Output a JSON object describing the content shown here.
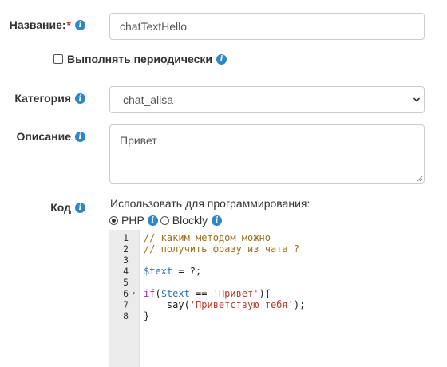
{
  "form": {
    "name": {
      "label": "Название:",
      "required_mark": "*",
      "value": "chatTextHello"
    },
    "periodic": {
      "label": "Выполнять периодически",
      "checked": false
    },
    "category": {
      "label": "Категория",
      "value": "chat_alisa"
    },
    "description": {
      "label": "Описание",
      "value": "Привет"
    },
    "code": {
      "label": "Код",
      "hint": "Использовать для программирования:",
      "options": [
        {
          "label": "PHP",
          "checked": true
        },
        {
          "label": "Blockly",
          "checked": false
        }
      ]
    }
  },
  "editor": {
    "line_numbers": [
      "1",
      "2",
      "3",
      "4",
      "5",
      "6",
      "7",
      "8"
    ],
    "lines": [
      [
        {
          "t": "comment",
          "v": "// каким методом можно"
        }
      ],
      [
        {
          "t": "comment",
          "v": "// получить фразу из чата ?"
        }
      ],
      [],
      [
        {
          "t": "var",
          "v": "$text"
        },
        {
          "t": "plain",
          "v": " = ?;"
        }
      ],
      [],
      [
        {
          "t": "kw",
          "v": "if"
        },
        {
          "t": "plain",
          "v": "("
        },
        {
          "t": "var",
          "v": "$text"
        },
        {
          "t": "plain",
          "v": " == "
        },
        {
          "t": "str",
          "v": "'Привет'"
        },
        {
          "t": "plain",
          "v": "){"
        }
      ],
      [
        {
          "t": "plain",
          "v": "    say("
        },
        {
          "t": "str",
          "v": "'Приветствую тебя'"
        },
        {
          "t": "plain",
          "v": ");"
        }
      ],
      [
        {
          "t": "plain",
          "v": "}"
        }
      ]
    ],
    "fold_line": "6"
  },
  "icons": {
    "info": "info-icon",
    "info_glyph": "i",
    "accent_color": "#2f86c8"
  }
}
